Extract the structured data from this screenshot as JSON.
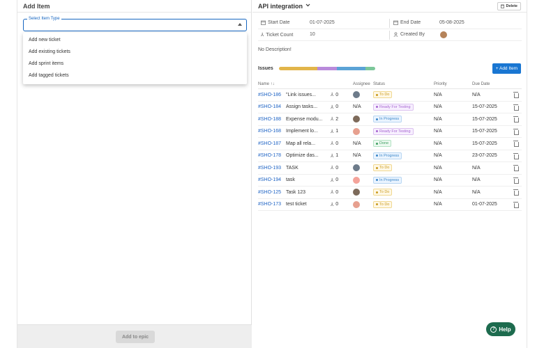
{
  "left_panel": {
    "title": "Add Item",
    "select": {
      "legend": "Select Item Type",
      "value": ""
    },
    "dropdown_options": [
      "Add new ticket",
      "Add existing tickets",
      "Add sprint items",
      "Add tagged tickets"
    ],
    "footer_button": "Add to epic"
  },
  "right_panel": {
    "title": "API integration",
    "delete_label": "Delete",
    "meta": {
      "start_date_label": "Start Date",
      "start_date_value": "01-07-2025",
      "end_date_label": "End Date",
      "end_date_value": "05-08-2025",
      "ticket_count_label": "Ticket Count",
      "ticket_count_value": "10",
      "created_by_label": "Created By"
    },
    "description": "No Description!",
    "issues_label": "Issues",
    "progress_segments": [
      {
        "status": "To Do",
        "fraction": 0.4,
        "color": "#e2b54a"
      },
      {
        "status": "Ready For Testing",
        "fraction": 0.2,
        "color": "#b98adb"
      },
      {
        "status": "In Progress",
        "fraction": 0.3,
        "color": "#5ba3d6"
      },
      {
        "status": "Done",
        "fraction": 0.1,
        "color": "#7cc79a"
      }
    ],
    "add_item_label": "+ Add Item",
    "columns": {
      "name": "Name ↑↓",
      "assignee": "Assignee",
      "status": "Status",
      "priority": "Priority",
      "due_date": "Due Date"
    },
    "rows": [
      {
        "key": "#SHO-186",
        "title": "\"Link issues...",
        "sub": "0",
        "assignee": "avatar",
        "status": "To Do",
        "priority": "N/A",
        "due": "N/A"
      },
      {
        "key": "#SHO-184",
        "title": "Assign tasks...",
        "sub": "0",
        "assignee": "N/A",
        "status": "Ready For Testing",
        "priority": "N/A",
        "due": "15-07-2025"
      },
      {
        "key": "#SHO-188",
        "title": "Expense modu...",
        "sub": "2",
        "assignee": "avatar",
        "status": "In Progress",
        "priority": "N/A",
        "due": "15-07-2025"
      },
      {
        "key": "#SHO-168",
        "title": "Implement lo...",
        "sub": "1",
        "assignee": "avatar",
        "status": "Ready For Testing",
        "priority": "N/A",
        "due": "15-07-2025"
      },
      {
        "key": "#SHO-187",
        "title": "Map all rela...",
        "sub": "0",
        "assignee": "N/A",
        "status": "Done",
        "priority": "N/A",
        "due": "15-07-2025"
      },
      {
        "key": "#SHO-178",
        "title": "Optimize das...",
        "sub": "1",
        "assignee": "N/A",
        "status": "In Progress",
        "priority": "N/A",
        "due": "23-07-2025"
      },
      {
        "key": "#SHO-193",
        "title": "TASK",
        "sub": "0",
        "assignee": "avatar",
        "status": "To Do",
        "priority": "N/A",
        "due": "N/A"
      },
      {
        "key": "#SHO-194",
        "title": "task",
        "sub": "0",
        "assignee": "avatar",
        "status": "In Progress",
        "priority": "N/A",
        "due": "N/A"
      },
      {
        "key": "#SHO-125",
        "title": "Task 123",
        "sub": "0",
        "assignee": "avatar",
        "status": "To Do",
        "priority": "N/A",
        "due": "N/A"
      },
      {
        "key": "#SHO-173",
        "title": "test ticket",
        "sub": "0",
        "assignee": "avatar",
        "status": "To Do",
        "priority": "N/A",
        "due": "01-07-2025"
      }
    ]
  },
  "help_label": "Help",
  "status_colors": {
    "To Do": {
      "fg": "#c99a1e",
      "bg": "#fff8e6",
      "border": "#f0d890"
    },
    "Ready For Testing": {
      "fg": "#a765d0",
      "bg": "#f7efff",
      "border": "#dcc1ef"
    },
    "In Progress": {
      "fg": "#3a86c8",
      "bg": "#eaf4ff",
      "border": "#b8d6f2"
    },
    "Done": {
      "fg": "#3f9e62",
      "bg": "#ecf9f0",
      "border": "#b3e2c3"
    }
  }
}
